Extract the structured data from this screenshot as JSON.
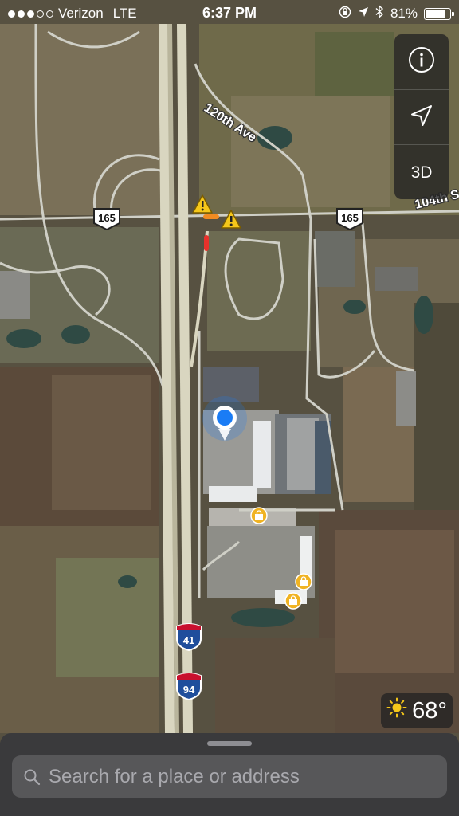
{
  "status_bar": {
    "carrier": "Verizon",
    "network": "LTE",
    "time": "6:37 PM",
    "battery_percent": "81%",
    "battery_level": 0.81,
    "signal_bars_filled": 3,
    "signal_bars_total": 5,
    "icons": [
      "orientation-lock-icon",
      "location-arrow-icon",
      "bluetooth-icon",
      "battery-icon"
    ]
  },
  "map": {
    "road_labels": {
      "avenue": "120th Ave",
      "avenue_east": "104th S"
    },
    "shields": {
      "route_left": "165",
      "route_right": "165",
      "interstate_a": "41",
      "interstate_b": "94"
    },
    "markers": [
      "traffic-warning-icon",
      "traffic-warning-icon",
      "user-location-icon",
      "shopping-bag-icon",
      "shopping-bag-icon",
      "shopping-bag-icon"
    ]
  },
  "controls": {
    "info_icon": "info-icon",
    "tracking_icon": "location-arrow-icon",
    "three_d_label": "3D"
  },
  "weather": {
    "icon": "sun-icon",
    "temperature": "68°"
  },
  "search": {
    "placeholder": "Search for a place or address"
  },
  "colors": {
    "warning_yellow": "#f5c71a",
    "user_location_blue": "#1a7cf5",
    "poi_gold": "#f0b323",
    "interstate_blue": "#1f4e9c",
    "interstate_red": "#c8102e"
  }
}
